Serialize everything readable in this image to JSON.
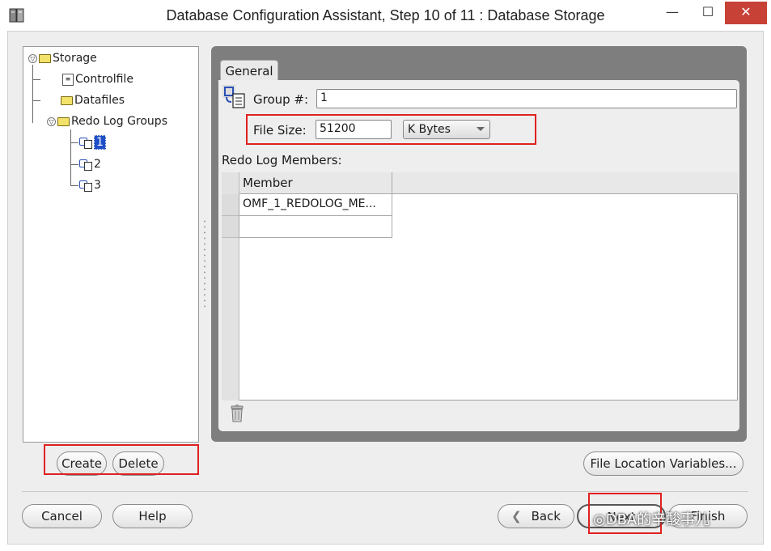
{
  "window": {
    "title": "Database Configuration Assistant, Step 10 of 11 : Database Storage",
    "min_glyph": "—",
    "max_glyph": "☐",
    "close_glyph": "✕"
  },
  "tree": {
    "items": [
      {
        "label": "Storage",
        "icon": "folder-icon"
      },
      {
        "label": "Controlfile",
        "icon": "controlfile-icon"
      },
      {
        "label": "Datafiles",
        "icon": "folder-icon"
      },
      {
        "label": "Redo Log Groups",
        "icon": "folder-icon"
      },
      {
        "label": "1",
        "icon": "redo-log-icon",
        "selected": true
      },
      {
        "label": "2",
        "icon": "redo-log-icon"
      },
      {
        "label": "3",
        "icon": "redo-log-icon"
      }
    ]
  },
  "tabs": [
    {
      "label": "General",
      "active": true
    }
  ],
  "form": {
    "group_label": "Group #:",
    "group_value": "1",
    "filesize_label": "File Size:",
    "filesize_value": "51200",
    "unit_value": "K Bytes",
    "members_title": "Redo Log Members:"
  },
  "table": {
    "columns": [
      "Member"
    ],
    "rows": [
      [
        "OMF_1_REDOLOG_ME..."
      ],
      [
        ""
      ]
    ]
  },
  "buttons": {
    "create": "Create",
    "delete": "Delete",
    "file_location": "File Location Variables...",
    "cancel": "Cancel",
    "help": "Help",
    "back": "Back",
    "next": "Next",
    "finish": "Finish"
  },
  "watermark": "DBA的辛酸事儿",
  "colors": {
    "highlight_red": "#e02020",
    "selection_blue": "#1f4fc8",
    "panel_gray": "#7e7e7e"
  }
}
